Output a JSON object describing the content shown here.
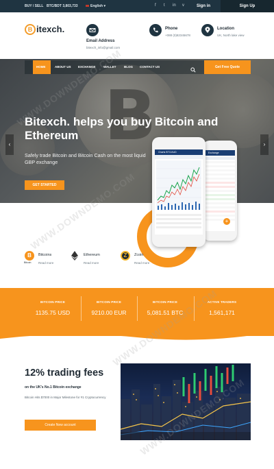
{
  "topbar": {
    "buy_sell": "BUY / SELL",
    "rate": "BTC/BDT 3,803,733",
    "language": "English",
    "sign_in": "Sign in",
    "sign_up": "Sign Up"
  },
  "brand": {
    "logo_letter": "B",
    "name": "itexch."
  },
  "contacts": [
    {
      "label": "Email Address",
      "value": "bitexch_info@gmail.com"
    },
    {
      "label": "Phone",
      "value": "+088 (0)82345678"
    },
    {
      "label": "Location",
      "value": "UK, North lake view"
    }
  ],
  "nav": {
    "items": [
      "HOME",
      "ABOUT US",
      "EXCHANGE",
      "WALLET",
      "BLOG",
      "CONTACT US"
    ],
    "cta": "Get Free Quote"
  },
  "hero": {
    "headline": "Bitexch. helps you buy Bitcoin and Ethereum",
    "subtitle": "Safely trade Bitcoin and Bitcoin Cash on the most liquid GBP exchange",
    "cta": "GET STARTED",
    "phone_main_title": "Charts BTC/AUD",
    "phone_back_title": "Exchange"
  },
  "currencies": [
    {
      "name": "Bitcoins",
      "sublabel": "Bitcoin",
      "link": "Read more"
    },
    {
      "name": "Ethereum",
      "link": "Read more"
    },
    {
      "name": "Zcoin",
      "link": "Read more"
    }
  ],
  "prices": [
    {
      "label": "BITCOIN PRICE",
      "value": "1135.75 USD"
    },
    {
      "label": "BITCOIN PRICE",
      "value": "9210.00 EUR"
    },
    {
      "label": "BITCOIN PRICE",
      "value": "5,081.51 BTC"
    },
    {
      "label": "ACTIVE TRADERS",
      "value": "1,561,171"
    }
  ],
  "fees": {
    "title": "12% trading fees",
    "subtitle": "on the UK's No.1 Bitcoin exchange",
    "text": "Bitcoin Hits $7000 in Major Milestone for #1 Cryptocurrency",
    "cta": "Create New account"
  },
  "watermark": "WWW.DOWNDEMO.COM",
  "colors": {
    "accent": "#f7941d",
    "dark": "#1f3441"
  }
}
